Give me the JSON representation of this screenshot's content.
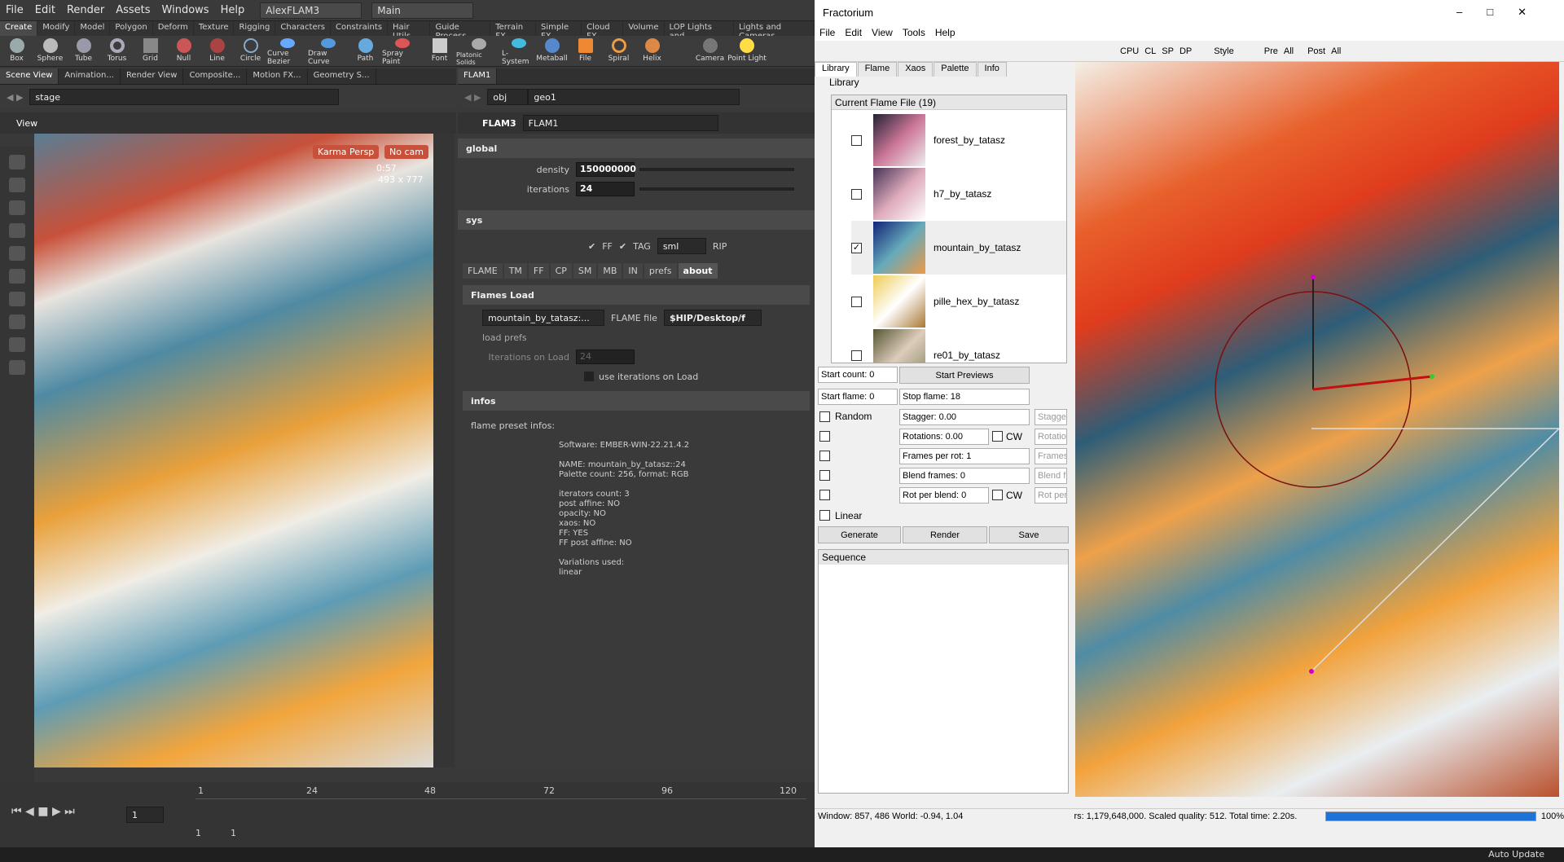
{
  "houdini": {
    "menu": [
      "File",
      "Edit",
      "Render",
      "Assets",
      "Windows",
      "Help"
    ],
    "desktop": "AlexFLAM3",
    "main": "Main",
    "shelf_tabs": [
      "Create",
      "Modify",
      "Model",
      "Polygon",
      "Deform",
      "Texture",
      "Rigging",
      "Characters",
      "Constraints",
      "Hair Utils",
      "Guide Process",
      "Terrain FX",
      "Simple FX",
      "Cloud FX",
      "Volume",
      "LOP Lights and...",
      "Lights and Cameras"
    ],
    "tools": [
      "Box",
      "Sphere",
      "Tube",
      "Torus",
      "Grid",
      "Null",
      "Line",
      "Circle",
      "Curve Bezier",
      "Draw Curve",
      "Path",
      "Spray Paint",
      "Font",
      "Platonic Solids",
      "L-System",
      "Metaball",
      "File",
      "Spiral",
      "Helix",
      "Camera",
      "Point Light"
    ],
    "pane_tabs": [
      "Scene View",
      "Animation...",
      "Render View",
      "Composite...",
      "Motion FX...",
      "Geometry S..."
    ],
    "net_tab": "FLAM3",
    "stage": "stage",
    "path1": "obj",
    "path2": "geo1",
    "view_label": "View",
    "cam": "Karma Persp",
    "nocam": "No cam",
    "res1": "0:57",
    "res2": "493 x 777",
    "node_type": "FLAM3",
    "node_name": "FLAM1",
    "global": "global",
    "density_label": "density",
    "density": "150000000",
    "iterations_label": "iterations",
    "iterations": "24",
    "sys": "sys",
    "ff": "FF",
    "tag": "TAG",
    "sml": "sml",
    "rip": "RIP",
    "tabs": [
      "FLAME",
      "TM",
      "FF",
      "CP",
      "SM",
      "MB",
      "IN",
      "prefs",
      "about"
    ],
    "flames_load": "Flames Load",
    "flame_select": "mountain_by_tatasz:...",
    "flame_file_label": "FLAME file",
    "flame_file": "$HIP/Desktop/f",
    "load_prefs": "load prefs",
    "iter_on_load": "Iterations on Load",
    "iter_on_load_val": "24",
    "use_iter": "use iterations on Load",
    "infos": "infos",
    "preset_infos": "flame preset infos:",
    "info_lines": [
      "Software: EMBER-WIN-22.21.4.2",
      "",
      "NAME: mountain_by_tatasz::24",
      "Palette count: 256, format: RGB",
      "",
      "iterators count: 3",
      "post affine: NO",
      "opacity: NO",
      "xaos: NO",
      "FF: YES",
      "FF post affine: NO",
      "",
      "Variations used:",
      "linear"
    ],
    "ticks": [
      "1",
      "24",
      "48",
      "72",
      "96",
      "120"
    ],
    "frame": "1",
    "start": "1",
    "end": "1"
  },
  "fractorium": {
    "title": "Fractorium",
    "menu": [
      "File",
      "Edit",
      "View",
      "Tools",
      "Help"
    ],
    "toolbar": [
      "CPU",
      "CL",
      "SP",
      "DP",
      "Style",
      "Pre",
      "All",
      "Post",
      "All"
    ],
    "tabs": [
      "Library",
      "Flame",
      "Xaos",
      "Palette",
      "Info"
    ],
    "library_label": "Library",
    "current_file": "Current Flame File (19)",
    "items": [
      {
        "name": "forest_by_tatasz",
        "checked": false
      },
      {
        "name": "h7_by_tatasz",
        "checked": false
      },
      {
        "name": "mountain_by_tatasz",
        "checked": true
      },
      {
        "name": "pille_hex_by_tatasz",
        "checked": false
      },
      {
        "name": "re01_by_tatasz",
        "checked": false
      }
    ],
    "start_count": "Start count: 0",
    "start_previews": "Start Previews",
    "start_flame": "Start flame: 0",
    "stop_flame": "Stop flame: 18",
    "random": "Random",
    "stagger": "Stagger: 0.00",
    "stagger2": "Stagger",
    "rotations": "Rotations: 0.00",
    "cw": "CW",
    "rotatio": "Rotatio",
    "frames_per_rot": "Frames per rot: 1",
    "frames": "Frames",
    "blend_frames": "Blend frames: 0",
    "blend_fr": "Blend fr",
    "rot_per_blend": "Rot per blend: 0",
    "rot_per": "Rot per",
    "linear": "Linear",
    "generate": "Generate",
    "render": "Render",
    "save": "Save",
    "sequence": "Sequence",
    "status_left": "Window:  857,  486 World: -0.94, 1.04",
    "status_right": "rs: 1,179,648,000. Scaled quality: 512. Total time: 2.20s.",
    "progress": 1.0,
    "progress_label": "100%"
  },
  "taskbar": {
    "auto_update": "Auto Update"
  }
}
